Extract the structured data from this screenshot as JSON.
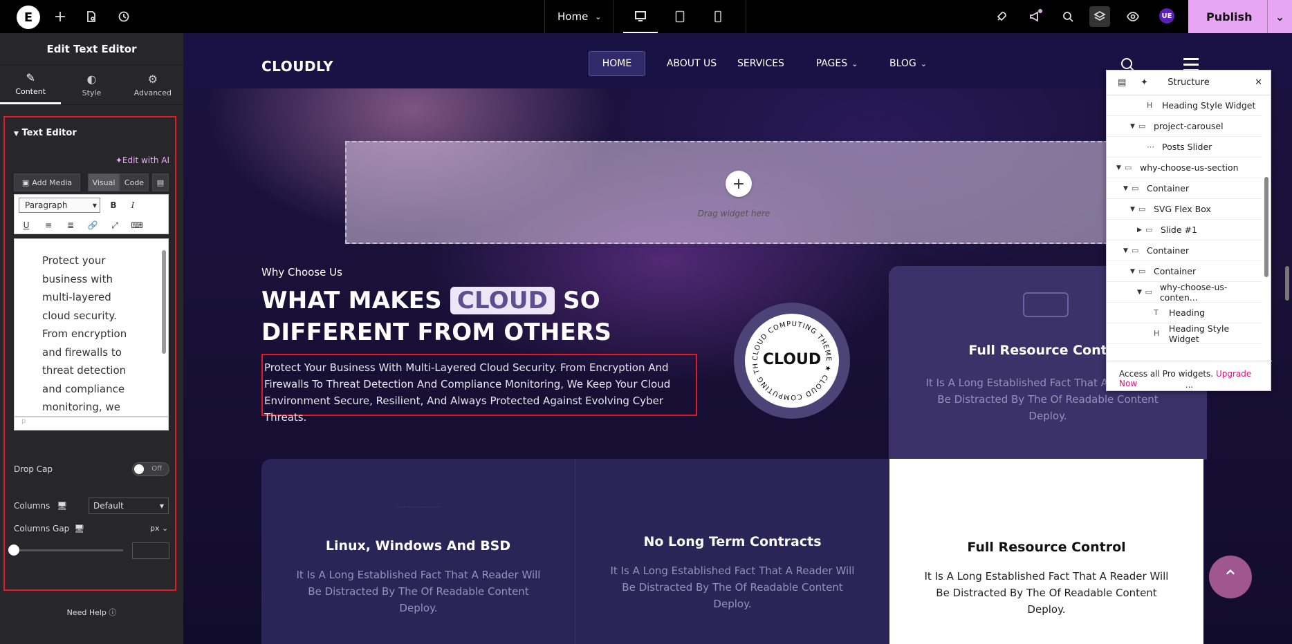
{
  "topbar": {
    "logo_label": "E",
    "page_selector": "Home",
    "publish_label": "Publish",
    "avatar_initials": "UE",
    "icons": [
      "plus-icon",
      "page-icon",
      "history-icon",
      "desktop-icon",
      "tablet-icon",
      "mobile-icon",
      "rocket-icon",
      "announce-icon",
      "search-icon",
      "layers-icon",
      "eye-icon"
    ]
  },
  "panel": {
    "title": "Edit Text Editor",
    "tabs": [
      {
        "label": "Content",
        "icon": "pencil-icon"
      },
      {
        "label": "Style",
        "icon": "half-circle-icon"
      },
      {
        "label": "Advanced",
        "icon": "gear-icon"
      }
    ],
    "section_title": "Text Editor",
    "edit_ai_label": "Edit with AI",
    "add_media_label": "Add Media",
    "visual_tab": "Visual",
    "code_tab": "Code",
    "format_select": "Paragraph",
    "editor_text": "Protect your business with multi-layered cloud security. From encryption and firewalls to threat detection and compliance monitoring, we keep your cloud",
    "editor_footer": "p",
    "drop_cap_label": "Drop Cap",
    "drop_cap_state": "Off",
    "columns_label": "Columns",
    "columns_value": "Default",
    "columns_gap_label": "Columns Gap",
    "columns_gap_unit": "px",
    "need_help": "Need Help"
  },
  "site": {
    "brand": "CLOUDLY",
    "menu": [
      "HOME",
      "ABOUT US",
      "SERVICES",
      "PAGES",
      "BLOG"
    ],
    "dropzone_text": "Drag widget here",
    "eyebrow": "Why Choose Us",
    "headline_a": "WHAT MAKES ",
    "headline_highlight": "CLOUD",
    "headline_b": " SO DIFFERENT FROM OTHERS",
    "paragraph": "Protect Your Business With Multi-Layered Cloud Security. From Encryption And Firewalls To Threat Detection And Compliance Monitoring, We Keep Your Cloud Environment Secure, Resilient, And Always Protected Against Evolving Cyber Threats.",
    "badge_center": "CLOUD",
    "badge_ring": "CLOUD COMPUTING THEME ★ CLOUD COMPUTING THEME ★",
    "top_card": {
      "title": "Full Resource Control",
      "text": "It Is A Long Established Fact That A Reader Will Be Distracted By The Of Readable Content Deploy."
    },
    "cards": [
      {
        "title": "Linux, Windows And BSD",
        "text": "It Is A Long Established Fact That A Reader Will Be Distracted By The Of Readable Content Deploy."
      },
      {
        "title": "No Long Term Contracts",
        "text": "It Is A Long Established Fact That A Reader Will Be Distracted By The Of Readable Content Deploy."
      },
      {
        "title": "Full Resource Control",
        "text": "It Is A Long Established Fact That A Reader Will Be Distracted By The Of Readable Content Deploy."
      }
    ]
  },
  "structure": {
    "title": "Structure",
    "rows": [
      {
        "label": "Heading Style Widget",
        "icon": "heading-icon",
        "expanded": null
      },
      {
        "label": "project-carousel",
        "icon": "container-icon",
        "expanded": true
      },
      {
        "label": "Posts Slider",
        "icon": "slider-icon",
        "expanded": null
      },
      {
        "label": "why-choose-us-section",
        "icon": "container-icon",
        "expanded": true
      },
      {
        "label": "Container",
        "icon": "container-icon",
        "expanded": true
      },
      {
        "label": "SVG Flex Box",
        "icon": "flexbox-icon",
        "expanded": true
      },
      {
        "label": "Slide #1",
        "icon": "container-icon",
        "expanded": false
      },
      {
        "label": "Container",
        "icon": "container-icon",
        "expanded": true
      },
      {
        "label": "Container",
        "icon": "container-icon",
        "expanded": true
      },
      {
        "label": "why-choose-us-conten...",
        "icon": "container-icon",
        "expanded": true
      },
      {
        "label": "Heading",
        "icon": "text-icon",
        "expanded": null
      },
      {
        "label": "Heading Style Widget",
        "icon": "heading-icon",
        "expanded": null
      }
    ],
    "footer_text": "Access all Pro widgets.",
    "upgrade_label": "Upgrade Now",
    "more_label": "..."
  },
  "colors": {
    "accent_publish": "#e7a6f1",
    "selection_red": "#e31b23",
    "card_bg": "#2b2456",
    "upgrade_link": "#d4127e"
  }
}
